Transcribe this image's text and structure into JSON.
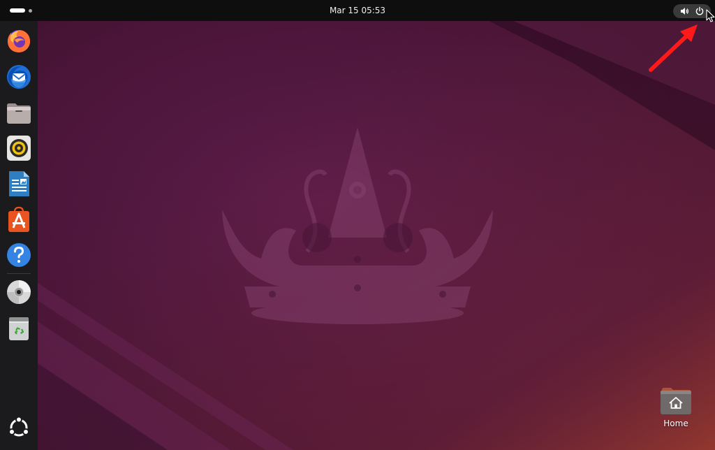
{
  "topbar": {
    "clock": "Mar 15  05:53",
    "icons": {
      "activities": "activities-indicator-icon",
      "volume": "volume-icon",
      "power": "power-icon"
    }
  },
  "dock": {
    "items": [
      {
        "name": "firefox",
        "icon": "firefox-icon"
      },
      {
        "name": "thunderbird",
        "icon": "thunderbird-icon"
      },
      {
        "name": "files",
        "icon": "files-folder-icon"
      },
      {
        "name": "rhythmbox",
        "icon": "rhythmbox-speaker-icon"
      },
      {
        "name": "libreoffice-writer",
        "icon": "libreoffice-writer-icon"
      },
      {
        "name": "app-center",
        "icon": "app-center-icon"
      },
      {
        "name": "help",
        "icon": "help-icon"
      },
      {
        "name": "disc",
        "icon": "disc-icon"
      },
      {
        "name": "trash",
        "icon": "trash-icon"
      },
      {
        "name": "show-apps",
        "icon": "show-apps-icon"
      }
    ]
  },
  "desktop": {
    "home_label": "Home",
    "home_icon": "home-folder-icon"
  },
  "annotation": {
    "arrow_color": "#ff1a1a"
  },
  "colors": {
    "accent": "#e95420",
    "wallpaper_base": "#4a1538",
    "topbar": "#0e0e0e",
    "dock": "#1b1b1d"
  }
}
